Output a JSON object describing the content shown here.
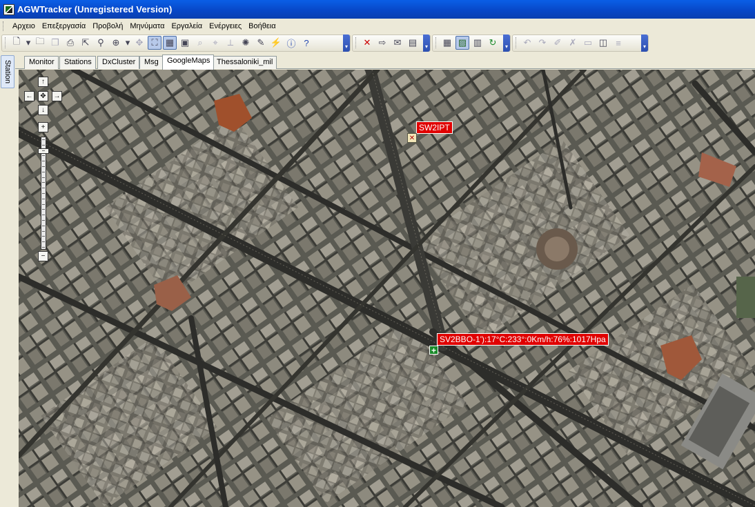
{
  "window": {
    "title": "AGWTracker (Unregistered Version)"
  },
  "menu": [
    "Αρχειο",
    "Επεξεργασία",
    "Προβολή",
    "Μηνύματα",
    "Εργαλεία",
    "Ενέργειες",
    "Βοήθεια"
  ],
  "toolbar": {
    "groups": [
      [
        "new-icon",
        "dropdown-icon",
        "open-folder-icon",
        "copy-icon",
        "print-icon",
        "export-icon",
        "find-icon",
        "zoom-in-icon",
        "dropdown-icon",
        "move-icon",
        "fit-icon",
        "grid-icon",
        "map-icon",
        "zoom-region-icon",
        "search-map-icon",
        "measure-icon",
        "rotate-icon",
        "pencil-icon",
        "lightning-icon",
        "info-icon",
        "help-icon"
      ],
      [
        "delete-icon",
        "send-icon",
        "mail-icon",
        "report-icon"
      ],
      [
        "table-icon",
        "image-icon",
        "document-icon",
        "refresh-icon"
      ],
      [
        "undo-icon",
        "redo-icon",
        "edit-icon",
        "cancel-icon",
        "screen-icon",
        "layout-icon",
        "list-icon"
      ]
    ]
  },
  "side_panel": {
    "tab_label": "Station"
  },
  "tabs": [
    {
      "label": "Monitor",
      "active": false
    },
    {
      "label": "Stations",
      "active": false
    },
    {
      "label": "DxCluster",
      "active": false
    },
    {
      "label": "Msg",
      "active": false
    },
    {
      "label": "GoogleMaps",
      "active": true
    },
    {
      "label": "Thessaloniki_mil",
      "active": false
    }
  ],
  "map": {
    "nav": {
      "up": "↑",
      "down": "↓",
      "left": "←",
      "right": "→",
      "center": "✥",
      "zoom_in": "+",
      "zoom_out": "−"
    },
    "zoom_level_fraction": 0.89,
    "stations": [
      {
        "callsign": "SW2IPT",
        "icon": "station-marker-icon"
      },
      {
        "callsign": "SV2BBO-1",
        "label": "SV2BBO-1'):17°C:233°:0Km/h:76%:1017Hpa",
        "icon": "weather-station-icon"
      }
    ]
  },
  "colors": {
    "label_bg": "#e00000",
    "titlebar": "#0a5fe6",
    "accent_toolbar_end": "#2c4fb0"
  }
}
